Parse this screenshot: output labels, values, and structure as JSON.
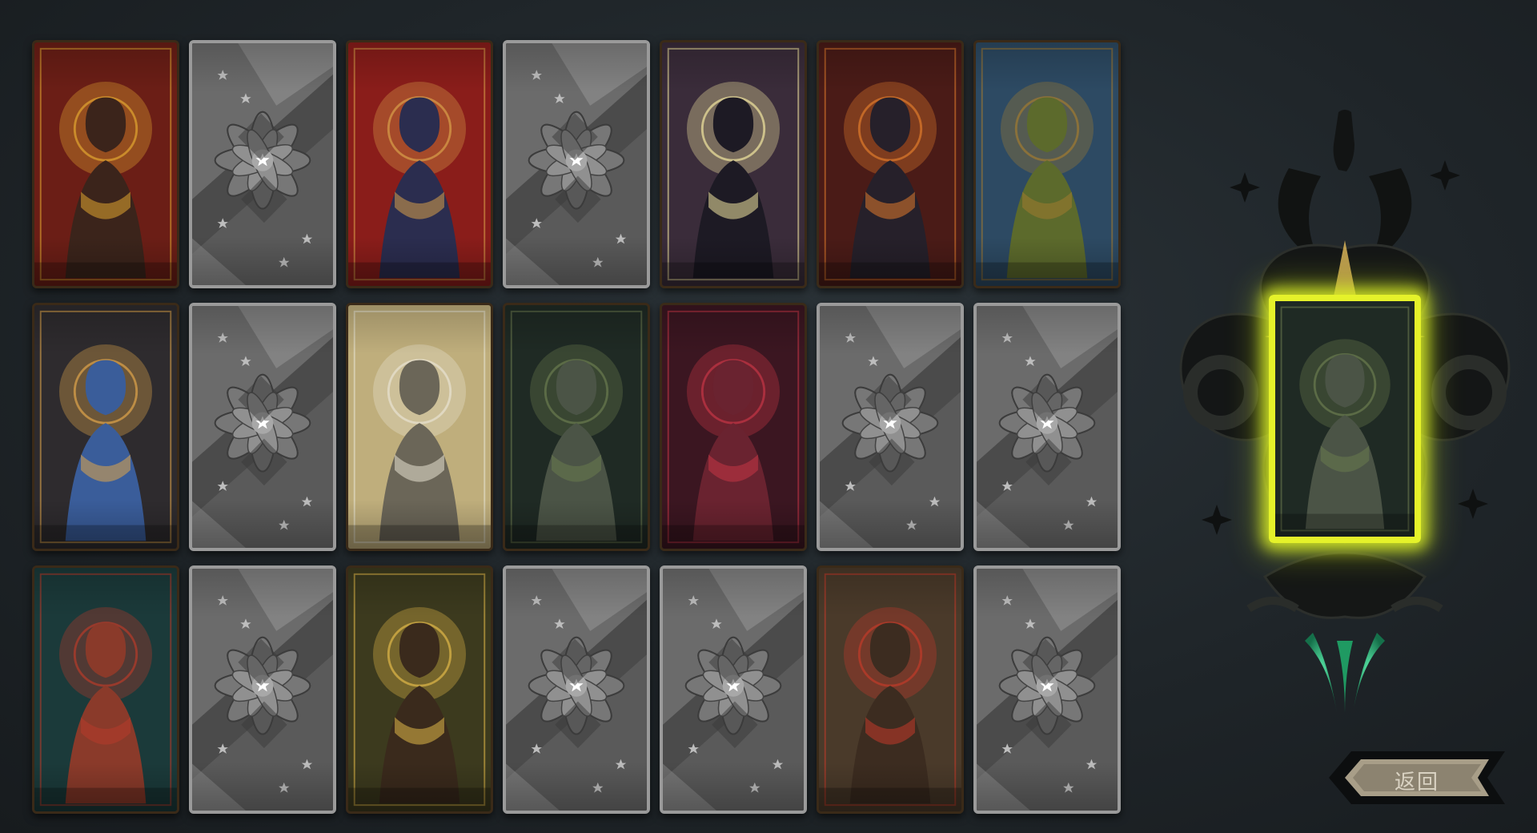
{
  "screen": "tarot-card-collection",
  "back_button": {
    "label": "返回"
  },
  "cards": [
    {
      "id": "king",
      "state": "revealed",
      "bg": "#6b1e16",
      "accent": "#e1a530",
      "figure": "#3b241b"
    },
    {
      "id": "locked",
      "state": "locked"
    },
    {
      "id": "wheel",
      "state": "revealed",
      "bg": "#8a1d1a",
      "accent": "#d8a04a",
      "figure": "#2b2d4f"
    },
    {
      "id": "locked",
      "state": "locked"
    },
    {
      "id": "tower",
      "state": "revealed",
      "bg": "#3a2c3a",
      "accent": "#f1e6a0",
      "figure": "#1d1a24"
    },
    {
      "id": "sun-warrior",
      "state": "revealed",
      "bg": "#4a1b17",
      "accent": "#e07a2b",
      "figure": "#26202a"
    },
    {
      "id": "four-faces",
      "state": "revealed",
      "bg": "#2d4a63",
      "accent": "#a17a30",
      "figure": "#5c6a2c"
    },
    {
      "id": "blue-shaman",
      "state": "revealed",
      "bg": "#2e2b2e",
      "accent": "#e0a54b",
      "figure": "#3a5d9a"
    },
    {
      "id": "locked",
      "state": "locked"
    },
    {
      "id": "hanged",
      "state": "revealed",
      "bg": "#bfae7c",
      "accent": "#e8e2d2",
      "figure": "#6b6658"
    },
    {
      "id": "reaper",
      "state": "revealed",
      "bg": "#1f2a24",
      "accent": "#6a7a4e",
      "figure": "#4b5446"
    },
    {
      "id": "demon",
      "state": "revealed",
      "bg": "#3b1621",
      "accent": "#c53646",
      "figure": "#6a2330"
    },
    {
      "id": "locked",
      "state": "locked"
    },
    {
      "id": "locked",
      "state": "locked"
    },
    {
      "id": "bird-dancer",
      "state": "revealed",
      "bg": "#1b3a3a",
      "accent": "#b63a2a",
      "figure": "#8a3a2a"
    },
    {
      "id": "locked",
      "state": "locked"
    },
    {
      "id": "archer",
      "state": "revealed",
      "bg": "#3c3a1e",
      "accent": "#e0b848",
      "figure": "#3a2a1c"
    },
    {
      "id": "locked",
      "state": "locked"
    },
    {
      "id": "locked",
      "state": "locked"
    },
    {
      "id": "chariot",
      "state": "revealed",
      "bg": "#4a3a2a",
      "accent": "#c23a2a",
      "figure": "#3c2c20"
    },
    {
      "id": "locked",
      "state": "locked"
    }
  ],
  "selected_card": {
    "id": "reaper",
    "glow": "#e5f22a"
  },
  "colors": {
    "background": "#1f2529",
    "altar": "#141616",
    "altar_edge": "#3a3a36",
    "gold": "#b8932e",
    "green_glow": "#2fd38a"
  }
}
